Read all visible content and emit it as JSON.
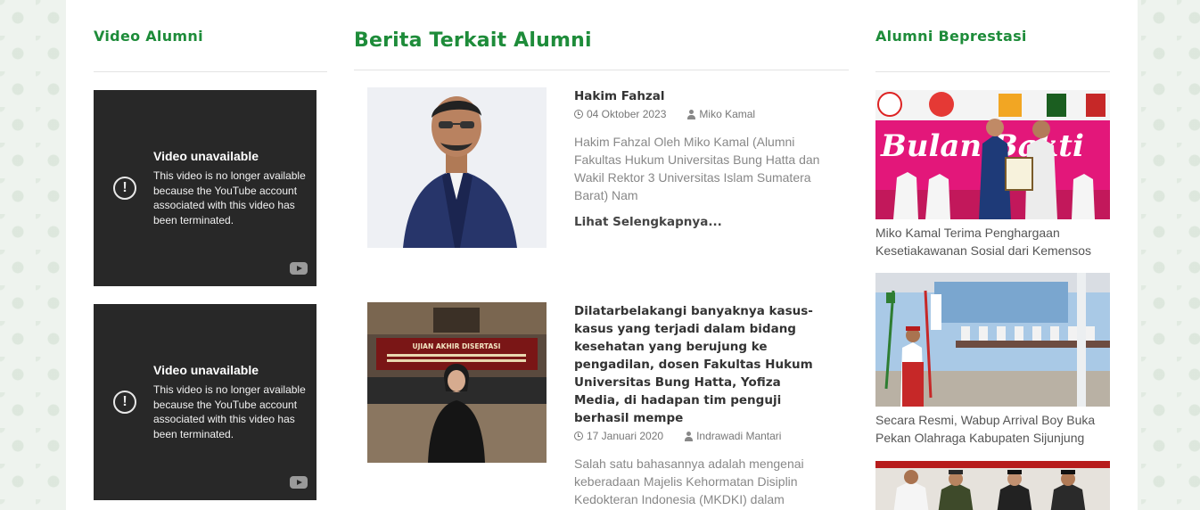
{
  "video_section": {
    "title": "Video Alumni",
    "videos": [
      {
        "title": "Video unavailable",
        "message": "This video is no longer available because the YouTube account associated with this video has been terminated."
      },
      {
        "title": "Video unavailable",
        "message": "This video is no longer available because the YouTube account associated with this video has been terminated."
      }
    ]
  },
  "news_section": {
    "title": "Berita Terkait Alumni",
    "articles": [
      {
        "title": "Hakim Fahzal",
        "date": "04 Oktober 2023",
        "author": "Miko Kamal",
        "excerpt": "Hakim Fahzal Oleh Miko Kamal (Alumni Fakultas Hukum Universitas Bung Hatta dan Wakil Rektor 3 Universitas Islam Sumatera Barat)   Nam",
        "read_more": "Lihat Selengkapnya..."
      },
      {
        "title": "Dilatarbelakangi banyaknya kasus-kasus yang terjadi dalam bidang kesehatan yang berujung ke pengadilan, dosen Fakultas Hukum Universitas Bung Hatta, Yofiza Media, di hadapan tim penguji berhasil mempe",
        "date": "17 Januari 2020",
        "author": "Indrawadi Mantari",
        "excerpt": "Salah satu bahasannya adalah mengenai keberadaan Majelis Kehormatan Disiplin Kedokteran Indonesia (MKDKI) dalam pemeriksaan dugaan malpraktek medik se",
        "banner": "UJIAN AKHIR DISERTASI"
      }
    ]
  },
  "achievement_section": {
    "title": "Alumni Beprestasi",
    "items": [
      {
        "caption": "Miko Kamal Terima Penghargaan Kesetiakawanan Sosial dari Kemensos",
        "banner": "Bulan Bakti"
      },
      {
        "caption": "Secara Resmi, Wabup Arrival Boy Buka Pekan Olahraga Kabupaten Sijunjung"
      },
      {
        "caption": ""
      }
    ]
  },
  "colors": {
    "accent": "#1e8c3a",
    "video_bg": "#282828",
    "muted_text": "#888888"
  }
}
